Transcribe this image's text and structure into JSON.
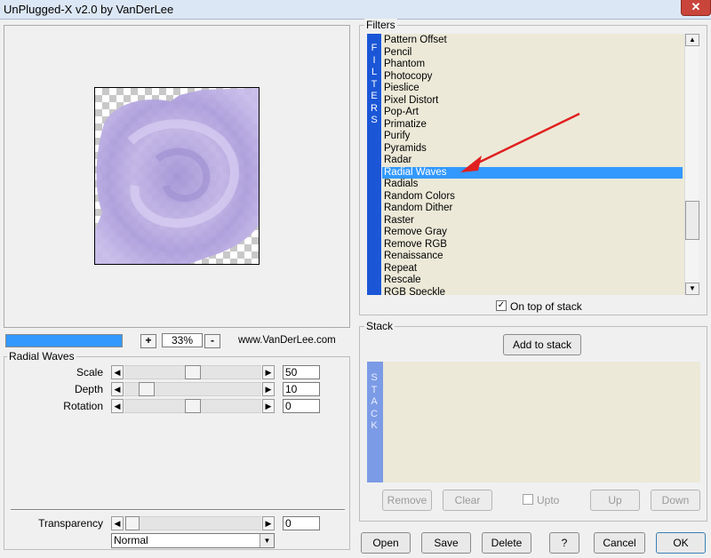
{
  "window": {
    "title": "UnPlugged-X v2.0 by VanDerLee",
    "close_label": "✕"
  },
  "preview": {
    "progress": 1.0,
    "zoom_in_label": "+",
    "zoom_out_label": "-",
    "zoom_value": "33%",
    "website": "www.VanDerLee.com"
  },
  "params": {
    "group_label": "Radial Waves",
    "rows": [
      {
        "label": "Scale",
        "value": "50",
        "level": 0.5
      },
      {
        "label": "Depth",
        "value": "10",
        "level": 0.1
      },
      {
        "label": "Rotation",
        "value": "0",
        "level": 0.5
      }
    ],
    "transparency": {
      "label": "Transparency",
      "value": "0",
      "level": 0.0
    },
    "blend_mode": "Normal"
  },
  "filters": {
    "group_label": "Filters",
    "side_letters": [
      "F",
      "I",
      "L",
      "T",
      "E",
      "R",
      "S"
    ],
    "items": [
      "Pattern Offset",
      "Pencil",
      "Phantom",
      "Photocopy",
      "Pieslice",
      "Pixel Distort",
      "Pop-Art",
      "Primatize",
      "Purify",
      "Pyramids",
      "Radar",
      "Radial Waves",
      "Radials",
      "Random Colors",
      "Random Dither",
      "Raster",
      "Remove Gray",
      "Remove RGB",
      "Renaissance",
      "Repeat",
      "Rescale",
      "RGB Speckle"
    ],
    "selected_index": 11,
    "on_top_checked": true,
    "on_top_label": "On top of stack"
  },
  "stack": {
    "group_label": "Stack",
    "add_label": "Add to stack",
    "side_letters": [
      "S",
      "T",
      "A",
      "C",
      "K"
    ],
    "remove_label": "Remove",
    "clear_label": "Clear",
    "upto_label": "Upto",
    "up_label": "Up",
    "down_label": "Down"
  },
  "bottom_buttons": {
    "open": "Open",
    "save": "Save",
    "delete": "Delete",
    "help": "?",
    "cancel": "Cancel",
    "ok": "OK"
  },
  "colors": {
    "selection": "#3399ff",
    "filters_sidebar": "#1a56d6",
    "stack_sidebar": "#7c9be6",
    "list_bg": "#ece9d8",
    "swirl": "#b5a6de",
    "arrow": "#e02020"
  }
}
